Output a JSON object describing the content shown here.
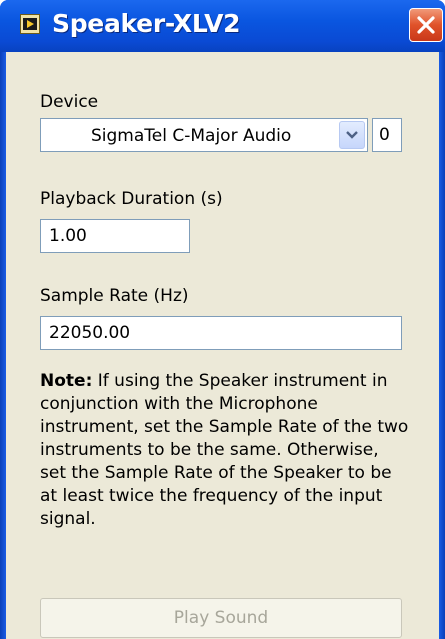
{
  "window": {
    "title": "Speaker-XLV2",
    "app_icon": "labview-app-icon",
    "close_icon": "close-icon"
  },
  "device": {
    "label": "Device",
    "selected": "SigmaTel C-Major Audio",
    "index": "0",
    "dropdown_icon": "chevron-down-icon"
  },
  "duration": {
    "label": "Playback Duration (s)",
    "value": "1.00"
  },
  "sample_rate": {
    "label": "Sample Rate (Hz)",
    "value": "22050.00"
  },
  "note": {
    "prefix": "Note:",
    "text": "If using the Speaker instrument in conjunction with the Microphone instrument, set the Sample Rate of the two instruments to be the same. Otherwise, set the Sample Rate of the Speaker to be at least twice the frequency of the input signal."
  },
  "play_button": {
    "label": "Play Sound",
    "enabled": false
  },
  "colors": {
    "titlebar": "#0a56e0",
    "client_bg": "#ece9d8",
    "close_button": "#e0522a",
    "disabled_text": "#a7a69a"
  }
}
